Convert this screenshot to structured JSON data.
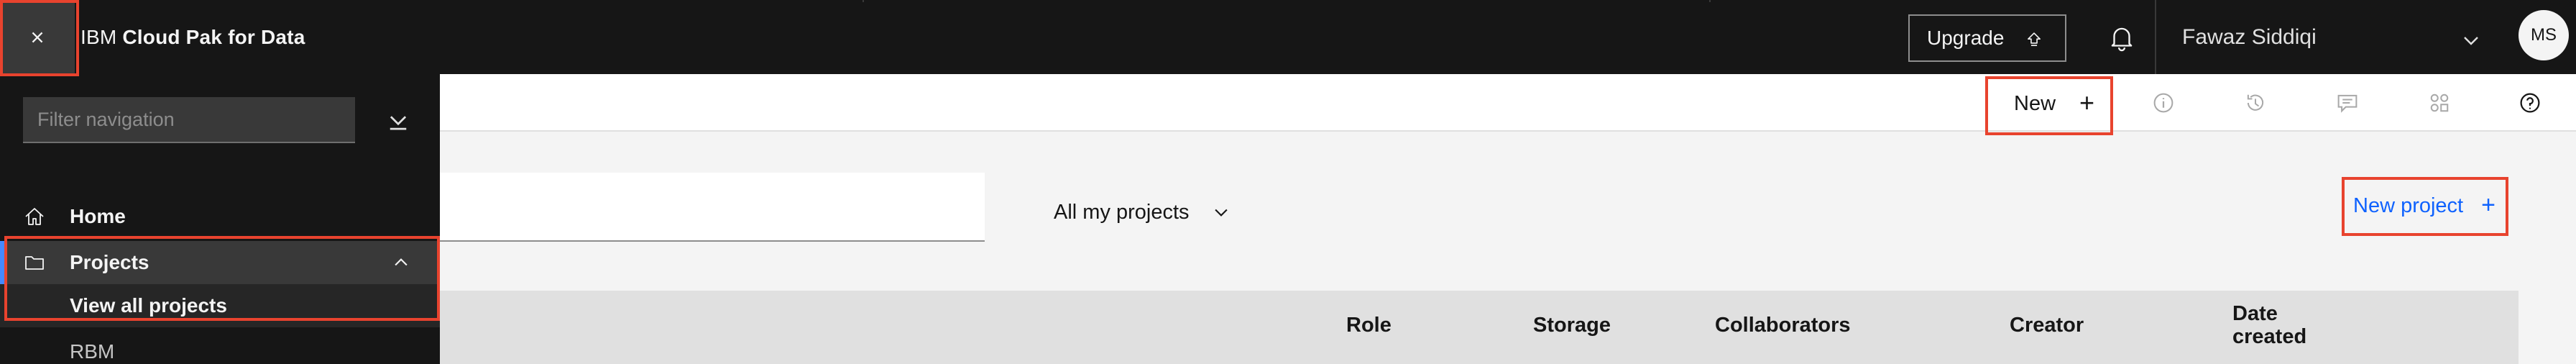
{
  "header": {
    "brand_prefix": "IBM",
    "brand_product": "Cloud Pak for Data",
    "upgrade_label": "Upgrade",
    "user_name": "Fawaz Siddiqi",
    "avatar_initials": "MS"
  },
  "toolbar": {
    "new_label": "New",
    "icons": [
      "info-icon",
      "history-icon",
      "chat-icon",
      "services-icon",
      "help-icon"
    ]
  },
  "sidenav": {
    "filter_placeholder": "Filter navigation",
    "home_label": "Home",
    "projects_label": "Projects",
    "view_all_projects_label": "View all projects",
    "rbm_label": "RBM"
  },
  "main": {
    "filter_label": "All my projects",
    "new_project_label": "New project",
    "table_columns": [
      "Role",
      "Storage",
      "Collaborators",
      "Creator",
      "Date created"
    ],
    "date_created_lines": [
      "Date",
      "created"
    ]
  },
  "colors": {
    "header_bg": "#161616",
    "accent_link": "#0f62fe",
    "highlight": "#e8432e",
    "active_nav": "#393939"
  }
}
